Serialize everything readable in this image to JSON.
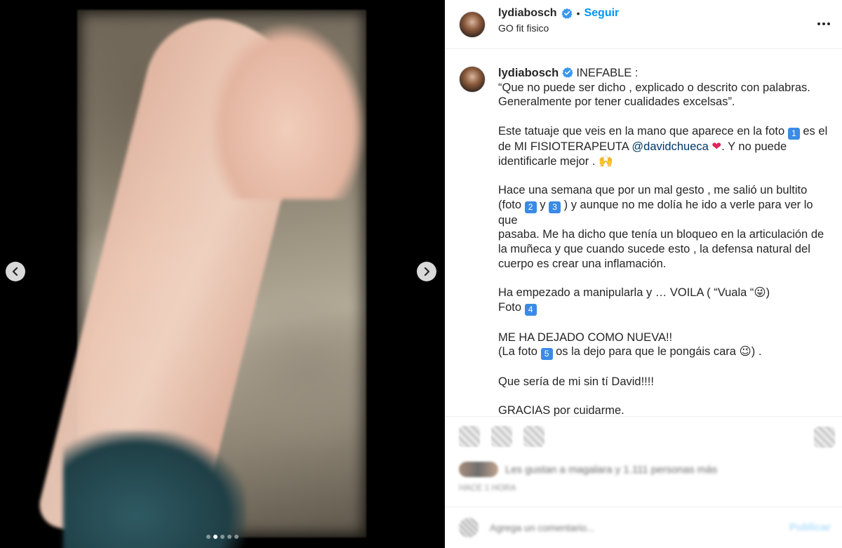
{
  "media": {
    "description_icon": "photo",
    "carousel": {
      "count": 5,
      "active_index": 1
    },
    "prev_icon": "chevron-left-icon",
    "next_icon": "chevron-right-icon"
  },
  "header": {
    "username": "lydiabosch",
    "verified": true,
    "separator": "•",
    "follow_label": "Seguir",
    "subtitle": "GO fit fisico",
    "more_icon": "more-horizontal-icon"
  },
  "caption": {
    "username": "lydiabosch",
    "paragraphs": [
      "INEFABLE :",
      "“Que no puede ser dicho , explicado o descrito con palabras. Generalmente por tener cualidades excelsas”.",
      "Este tatuaje que veis en la mano que aparece en la foto 1️⃣ es el de MI FISIOTERAPEUTA @davidchueca ❤️. Y no puede identificarle mejor . 🙌🏻",
      "Hace una semana que por un mal gesto , me salió un bultito (foto 2️⃣ y 3️⃣ ) y aunque no me dolía he ido a verle para ver lo que pasaba. Me ha dicho que tenía un bloqueo en la articulación de la muñeca y que cuando sucede esto , la defensa natural del cuerpo es crear una inflamación.",
      "Ha empezado a manipularla y … VOILA ( “Vuala “😜) Foto 4️⃣",
      "ME HA DEJADO COMO NUEVA!! (La foto 5️⃣ os la dejo para que le pongáis cara 😉) .",
      "Que sería de mi sin tí David!!!!",
      "GRACIAS por cuidarme."
    ],
    "line_inefable": "INEFABLE :",
    "line_quote_1": "“Que no puede ser dicho , explicado o descrito con palabras.",
    "line_quote_2": "Generalmente por tener cualidades excelsas”.",
    "p2_a": "Este tatuaje que veis en la mano que aparece en la foto ",
    "p2_num1": "1",
    "p2_b": " es el",
    "p2_c": "de MI FISIOTERAPEUTA ",
    "p2_mention": "@davidchueca",
    "p2_heart": " ❤",
    "p2_d": ". Y no puede",
    "p2_e": "identificarle mejor . 🙌",
    "p3_a": "Hace una semana que por un mal gesto , me salió un bultito",
    "p3_b": "(foto ",
    "p3_num2": "2",
    "p3_y": " y ",
    "p3_num3": "3",
    "p3_c": " ) y aunque no me dolía he ido a verle para ver lo que",
    "p3_d": "pasaba. Me ha dicho que tenía un bloqueo en la articulación de",
    "p3_e": "la muñeca y que cuando sucede esto , la defensa natural del",
    "p3_f": "cuerpo es crear una inflamación.",
    "p4_a": "Ha empezado a manipularla y … VOILA ( “Vuala “😜)",
    "p4_b": "Foto ",
    "p4_num4": "4",
    "p5_a": "ME HA DEJADO COMO NUEVA!!",
    "p5_b": "(La foto ",
    "p5_num5": "5",
    "p5_c": " os la dejo para que le pongáis cara 😉) .",
    "p6": "Que sería de mi sin tí David!!!!",
    "p7": "GRACIAS por cuidarme."
  },
  "actions": {
    "like_icon": "heart-icon",
    "comment_icon": "comment-icon",
    "share_icon": "share-icon",
    "save_icon": "bookmark-icon",
    "likes_text": "Les gustan a magalara y 1.111 personas más",
    "timestamp": "HACE 1 HORA"
  },
  "comment": {
    "emoji_icon": "emoji-icon",
    "placeholder": "Agrega un comentario...",
    "post_label": "Publicar"
  },
  "colors": {
    "accent": "#0095f6",
    "verified": "#3897f0",
    "mention": "#00376b",
    "keycap": "#3b8be6"
  }
}
